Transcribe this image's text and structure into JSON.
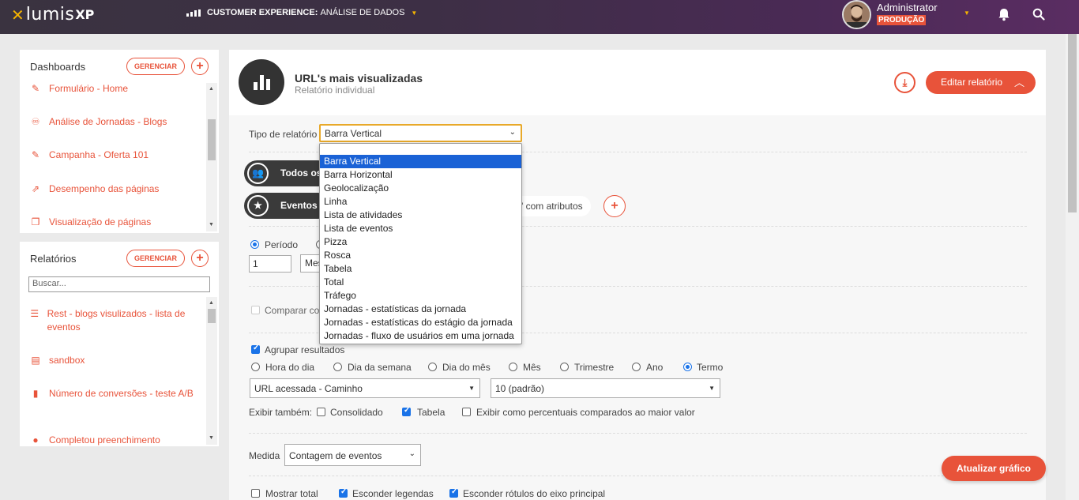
{
  "topbar": {
    "logo_lumis": "lumis",
    "logo_xp": "XP",
    "context_label": "CUSTOMER EXPERIENCE:",
    "context_value": "ANÁLISE DE DADOS",
    "user_name": "Administrator",
    "environment": "PRODUÇÃO"
  },
  "dashboards": {
    "title": "Dashboards",
    "manage_label": "GERENCIAR",
    "add_label": "+",
    "items": [
      {
        "label": "Formulário - Home",
        "icon": "edit-icon"
      },
      {
        "label": "Análise de Jornadas - Blogs",
        "icon": "journey-icon"
      },
      {
        "label": "Campanha - Oferta 101",
        "icon": "edit-icon"
      },
      {
        "label": "Desempenho das páginas",
        "icon": "external-edit-icon"
      },
      {
        "label": "Visualização de páginas",
        "icon": "copy-icon"
      }
    ]
  },
  "reports": {
    "title": "Relatórios",
    "manage_label": "GERENCIAR",
    "add_label": "+",
    "search_placeholder": "Buscar...",
    "items": [
      {
        "label": "Rest - blogs visulizados - lista de eventos",
        "icon": "list-icon"
      },
      {
        "label": "sandbox",
        "icon": "layout-icon"
      },
      {
        "label": "Número de conversões - teste A/B",
        "icon": "bar-chart-icon"
      },
      {
        "label": "Completou preenchimento",
        "icon": "pie-icon"
      }
    ]
  },
  "report": {
    "title": "URL's mais visualizadas",
    "subtitle": "Relatório individual",
    "edit_label": "Editar relatório",
    "report_type_label": "Tipo de relatório",
    "report_type_value": "Barra Vertical",
    "users_pill": "Todos os",
    "events_pill": "Eventos",
    "events_attr_text": "\" com atributos",
    "period_label": "Período",
    "period_value": "1",
    "period_unit": "Mes",
    "compare_label": "Comparar co",
    "group_label": "Agrupar resultados",
    "group_options": [
      "Hora do dia",
      "Dia da semana",
      "Dia do mês",
      "Mês",
      "Trimestre",
      "Ano",
      "Termo"
    ],
    "group_selected": "Termo",
    "group_field": "URL acessada - Caminho",
    "limit_field": "10 (padrão)",
    "show_also_label": "Exibir também:",
    "show_also_options": [
      {
        "label": "Consolidado",
        "checked": false
      },
      {
        "label": "Tabela",
        "checked": true
      },
      {
        "label": "Exibir como percentuais comparados ao maior valor",
        "checked": false
      }
    ],
    "measure_label": "Medida",
    "measure_value": "Contagem de eventos",
    "bottom_options": [
      {
        "label": "Mostrar total",
        "checked": false
      },
      {
        "label": "Esconder legendas",
        "checked": true
      },
      {
        "label": "Esconder rótulos do eixo principal",
        "checked": true
      }
    ],
    "update_label": "Atualizar gráfico"
  },
  "dropdown": {
    "options": [
      "",
      "Barra Vertical",
      "Barra Horizontal",
      "Geolocalização",
      "Linha",
      "Lista de atividades",
      "Lista de eventos",
      "Pizza",
      "Rosca",
      "Tabela",
      "Total",
      "Tráfego",
      "Jornadas - estatísticas da jornada",
      "Jornadas - estatísticas do estágio da jornada",
      "Jornadas - fluxo de usuários em uma jornada"
    ],
    "selected": "Barra Vertical"
  },
  "colors": {
    "accent": "#e8533a",
    "brand_yellow": "#f5b400",
    "selection_blue": "#1a62d6"
  }
}
